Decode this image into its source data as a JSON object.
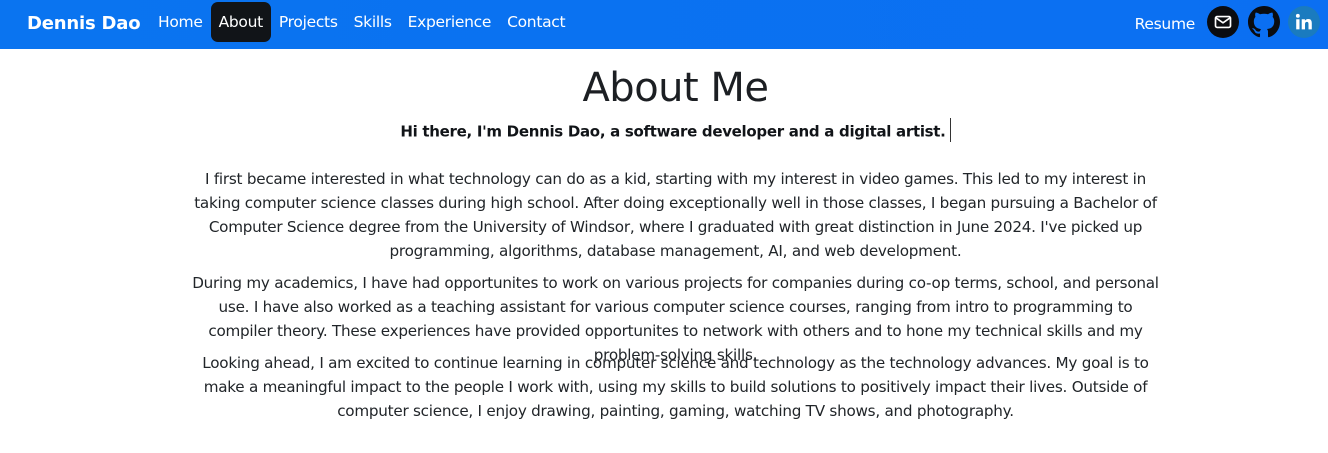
{
  "navbar": {
    "brand": "Dennis Dao",
    "links": [
      {
        "label": "Home"
      },
      {
        "label": "About",
        "active": true
      },
      {
        "label": "Projects"
      },
      {
        "label": "Skills"
      },
      {
        "label": "Experience"
      },
      {
        "label": "Contact"
      }
    ],
    "resume_label": "Resume",
    "icons": [
      "mail-icon",
      "github-icon",
      "linkedin-icon"
    ],
    "colors": {
      "background": "#0a74f0",
      "active_link_bg": "#111418",
      "linkedin": "#1a7bbf"
    }
  },
  "about": {
    "title": "About Me",
    "subtitle": "Hi there, I'm Dennis Dao, a software developer and a digital artist.",
    "paragraphs": [
      "I first became interested in what technology can do as a kid, starting with my interest in video games. This led to my interest in taking computer science classes during high school. After doing exceptionally well in those classes, I began pursuing a Bachelor of Computer Science degree from the University of Windsor, where I graduated with great distinction in June 2024. I've picked up programming, algorithms, database management, AI, and web development.",
      "During my academics, I have had opportunites to work on various projects for companies during co-op terms, school, and personal use. I have also worked as a teaching assistant for various computer science courses, ranging from intro to programming to compiler theory. These experiences have provided opportunites to network with others and to hone my technical skills and my problem-solving skills.",
      "Looking ahead, I am excited to continue learning in computer science and technology as the technology advances. My goal is to make a meaningful impact to the people I work with, using my skills to build solutions to positively impact their lives. Outside of computer science, I enjoy drawing, painting, gaming, watching TV shows, and photography."
    ]
  }
}
